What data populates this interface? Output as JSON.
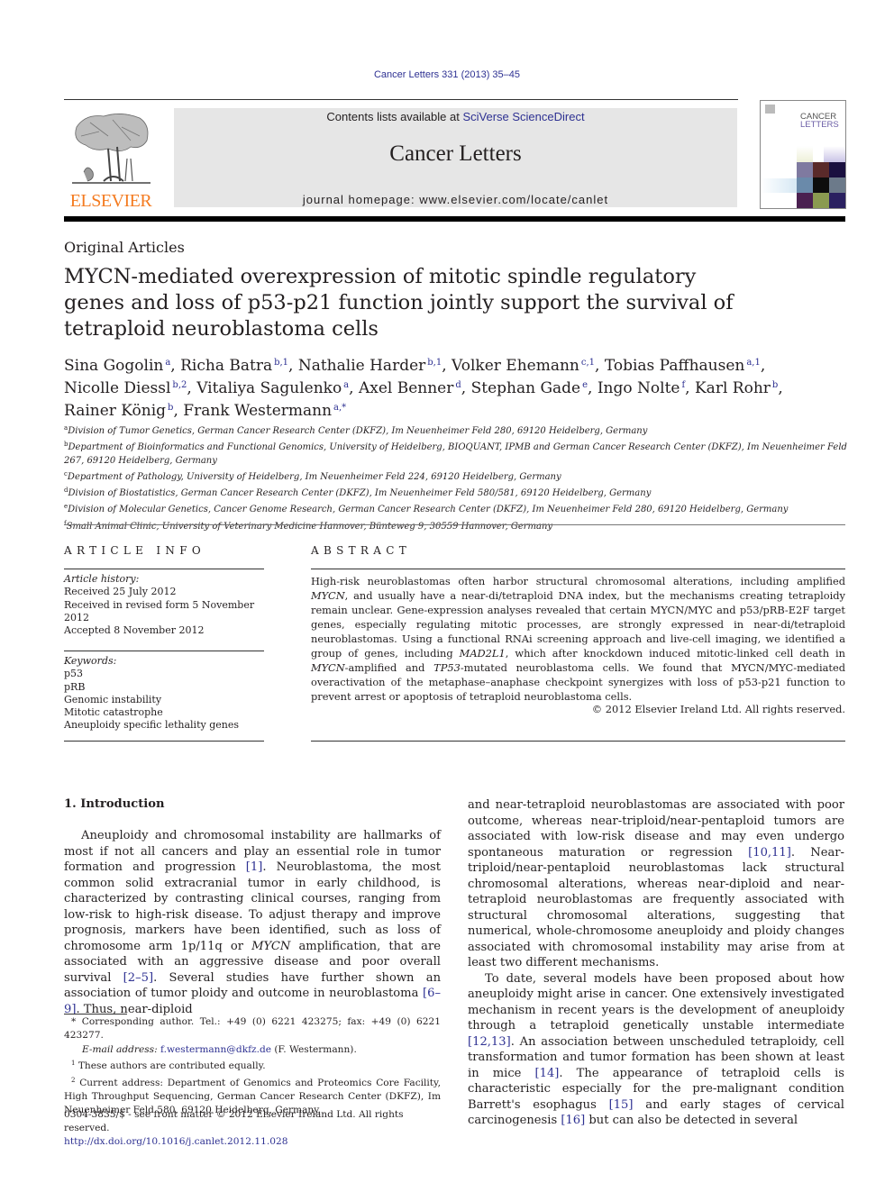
{
  "header": {
    "journal_citation": "Cancer Letters 331 (2013) 35–45",
    "contents_prefix": "Contents lists available at ",
    "contents_link": "SciVerse ScienceDirect",
    "journal_title": "Cancer Letters",
    "homepage_label": "journal homepage: www.elsevier.com/locate/canlet",
    "publisher_logo_text": "ELSEVIER",
    "cover_title_line1": "CANCER",
    "cover_title_line2": "LETTERS",
    "brand_color": "#f47b20",
    "link_color": "#2e3192"
  },
  "article": {
    "section_type": "Original Articles",
    "title": "MYCN-mediated overexpression of mitotic spindle regulatory genes and loss of p53-p21 function jointly support the survival of tetraploid neuroblastoma cells",
    "authors": [
      {
        "name": "Sina Gogolin",
        "sup": "a",
        "sep": ", "
      },
      {
        "name": "Richa Batra",
        "sup": "b,1",
        "sep": ", "
      },
      {
        "name": "Nathalie Harder",
        "sup": "b,1",
        "sep": ", "
      },
      {
        "name": "Volker Ehemann",
        "sup": "c,1",
        "sep": ", "
      },
      {
        "name": "Tobias Paffhausen",
        "sup": "a,1",
        "sep": ", "
      },
      {
        "name": "Nicolle Diessl",
        "sup": "b,2",
        "sep": ", "
      },
      {
        "name": "Vitaliya Sagulenko",
        "sup": "a",
        "sep": ", "
      },
      {
        "name": "Axel Benner",
        "sup": "d",
        "sep": ", "
      },
      {
        "name": "Stephan Gade",
        "sup": "e",
        "sep": ", "
      },
      {
        "name": "Ingo Nolte",
        "sup": "f",
        "sep": ", "
      },
      {
        "name": "Karl Rohr",
        "sup": "b",
        "sep": ", "
      },
      {
        "name": "Rainer König",
        "sup": "b",
        "sep": ", "
      },
      {
        "name": "Frank Westermann",
        "sup": "a,*",
        "sep": ""
      }
    ],
    "affiliations": [
      {
        "key": "a",
        "text": "Division of Tumor Genetics, German Cancer Research Center (DKFZ), Im Neuenheimer Feld 280, 69120 Heidelberg, Germany"
      },
      {
        "key": "b",
        "text": "Department of Bioinformatics and Functional Genomics, University of Heidelberg, BIOQUANT, IPMB and German Cancer Research Center (DKFZ), Im Neuenheimer Feld 267, 69120 Heidelberg, Germany"
      },
      {
        "key": "c",
        "text": "Department of Pathology, University of Heidelberg, Im Neuenheimer Feld 224, 69120 Heidelberg, Germany"
      },
      {
        "key": "d",
        "text": "Division of Biostatistics, German Cancer Research Center (DKFZ), Im Neuenheimer Feld 580/581, 69120 Heidelberg, Germany"
      },
      {
        "key": "e",
        "text": "Division of Molecular Genetics, Cancer Genome Research, German Cancer Research Center (DKFZ), Im Neuenheimer Feld 280, 69120 Heidelberg, Germany"
      },
      {
        "key": "f",
        "text": "Small Animal Clinic, University of Veterinary Medicine Hannover, Bünteweg 9, 30559 Hannover, Germany"
      }
    ]
  },
  "article_info": {
    "heading": "ARTICLE INFO",
    "history_label": "Article history:",
    "history": [
      "Received 25 July 2012",
      "Received in revised form 5 November 2012",
      "Accepted 8 November 2012"
    ],
    "keywords_label": "Keywords:",
    "keywords": [
      "p53",
      "pRB",
      "Genomic instability",
      "Mitotic catastrophe",
      "Aneuploidy specific lethality genes"
    ]
  },
  "abstract": {
    "heading": "ABSTRACT",
    "segments": [
      {
        "t": "High-risk neuroblastomas often harbor structural chromosomal alterations, including amplified "
      },
      {
        "t": "MYCN",
        "i": true
      },
      {
        "t": ", and usually have a near-di/tetraploid DNA index, but the mechanisms creating tetraploidy remain unclear. Gene-expression analyses revealed that certain MYCN/MYC and p53/pRB-E2F target genes, especially regulating mitotic processes, are strongly expressed in near-di/tetraploid neuroblastomas. Using a functional RNAi screening approach and live-cell imaging, we identified a group of genes, including "
      },
      {
        "t": "MAD2L1",
        "i": true
      },
      {
        "t": ", which after knockdown induced mitotic-linked cell death in "
      },
      {
        "t": "MYCN",
        "i": true
      },
      {
        "t": "-amplified and "
      },
      {
        "t": "TP53",
        "i": true
      },
      {
        "t": "-mutated neuroblastoma cells. We found that MYCN/MYC-mediated overactivation of the metaphase–anaphase checkpoint synergizes with loss of p53-p21 function to prevent arrest or apoptosis of tetraploid neuroblastoma cells."
      }
    ],
    "copyright": "© 2012 Elsevier Ireland Ltd. All rights reserved."
  },
  "body": {
    "intro_heading": "1. Introduction",
    "left_paragraph": [
      {
        "t": "Aneuploidy and chromosomal instability are hallmarks of most if not all cancers and play an essential role in tumor formation and progression "
      },
      {
        "t": "[1]",
        "r": true
      },
      {
        "t": ". Neuroblastoma, the most common solid extracranial tumor in early childhood, is characterized by contrasting clinical courses, ranging from low-risk to high-risk disease. To adjust therapy and improve prognosis, markers have been identified, such as loss of chromosome arm 1p/11q or "
      },
      {
        "t": "MYCN",
        "i": true
      },
      {
        "t": " amplification, that are associated with an aggressive disease and poor overall survival "
      },
      {
        "t": "[2–5]",
        "r": true
      },
      {
        "t": ". Several studies have further shown an association of tumor ploidy and outcome in neuroblastoma "
      },
      {
        "t": "[6–9]",
        "r": true
      },
      {
        "t": ". Thus, near-diploid"
      }
    ],
    "right_paragraph_1": [
      {
        "t": "and near-tetraploid neuroblastomas are associated with poor outcome, whereas near-triploid/near-pentaploid tumors are associated with low-risk disease and may even undergo spontaneous maturation or regression "
      },
      {
        "t": "[10,11]",
        "r": true
      },
      {
        "t": ". Near-triploid/near-pentaploid neuroblastomas lack structural chromosomal alterations, whereas near-diploid and near-tetraploid neuroblastomas are frequently associated with structural chromosomal alterations, suggesting that numerical, whole-chromosome aneuploidy and ploidy changes associated with chromosomal instability may arise from at least two different mechanisms."
      }
    ],
    "right_paragraph_2": [
      {
        "t": "To date, several models have been proposed about how aneuploidy might arise in cancer. One extensively investigated mechanism in recent years is the development of aneuploidy through a tetraploid genetically unstable intermediate "
      },
      {
        "t": "[12,13]",
        "r": true
      },
      {
        "t": ". An association between unscheduled tetraploidy, cell transformation and tumor formation has been shown at least in mice "
      },
      {
        "t": "[14]",
        "r": true
      },
      {
        "t": ". The appearance of tetraploid cells is characteristic especially for the pre-malignant condition Barrett's esophagus "
      },
      {
        "t": "[15]",
        "r": true
      },
      {
        "t": " and early stages of cervical carcinogenesis "
      },
      {
        "t": "[16]",
        "r": true
      },
      {
        "t": " but can also be detected in several"
      }
    ]
  },
  "footnotes": {
    "corresponding_mark": "*",
    "corresponding": "Corresponding author. Tel.: +49 (0) 6221 423275; fax: +49 (0) 6221 423277.",
    "email_label": "E-mail address: ",
    "email": "f.westermann@dkfz.de",
    "email_suffix": " (F. Westermann).",
    "fn1_mark": "1",
    "fn1": "These authors are contributed equally.",
    "fn2_mark": "2",
    "fn2": "Current address: Department of Genomics and Proteomics Core Facility, High Throughput Sequencing, German Cancer Research Center (DKFZ), Im Neuenheimer Feld 580, 69120 Heidelberg, Germany."
  },
  "bottom": {
    "issn_line": "0304-3835/$ - see front matter © 2012 Elsevier Ireland Ltd. All rights reserved.",
    "doi": "http://dx.doi.org/10.1016/j.canlet.2012.11.028"
  }
}
